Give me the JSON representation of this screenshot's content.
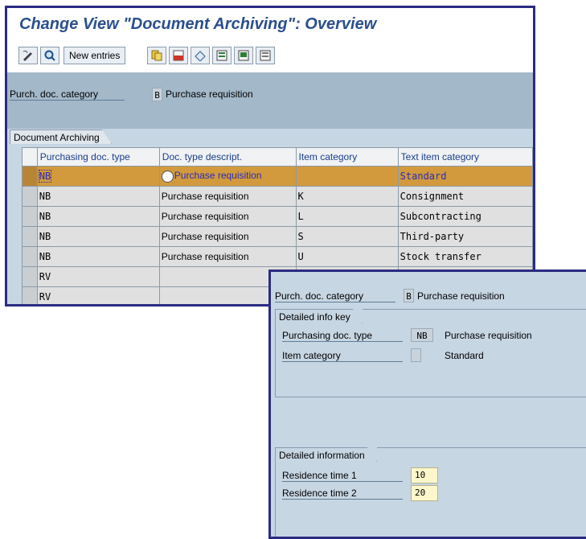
{
  "main_window": {
    "title": "Change View \"Document Archiving\": Overview",
    "toolbar": {
      "new_entries_label": "New entries"
    },
    "header": {
      "category_label": "Purch. doc. category",
      "category_key": "B",
      "category_text": "Purchase requisition"
    },
    "section_title": "Document Archiving",
    "table": {
      "columns": [
        "Purchasing doc. type",
        "Doc. type descript.",
        "Item category",
        "Text item category"
      ],
      "rows": [
        [
          "NB",
          "Purchase requisition",
          "",
          "Standard"
        ],
        [
          "NB",
          "Purchase requisition",
          "K",
          "Consignment"
        ],
        [
          "NB",
          "Purchase requisition",
          "L",
          "Subcontracting"
        ],
        [
          "NB",
          "Purchase requisition",
          "S",
          "Third-party"
        ],
        [
          "NB",
          "Purchase requisition",
          "U",
          "Stock transfer"
        ],
        [
          "RV",
          "",
          "",
          ""
        ],
        [
          "RV",
          "",
          "",
          ""
        ]
      ],
      "highlighted_row": 0,
      "highlight_color": "#d29a3c"
    }
  },
  "detail_window": {
    "category_label": "Purch. doc. category",
    "category_key": "B",
    "category_text": "Purchase requisition",
    "info_key_title": "Detailed info key",
    "doc_type_label": "Purchasing doc. type",
    "doc_type_value": "NB",
    "doc_type_text": "Purchase requisition",
    "item_category_label": "Item category",
    "item_category_value": "",
    "item_category_text": "Standard",
    "info_title": "Detailed information",
    "residence1_label": "Residence time 1",
    "residence1_value": "10",
    "residence2_label": "Residence time 2",
    "residence2_value": "20"
  },
  "colors": {
    "frame_border": "#2b2b82",
    "title_text": "#2a4f8f",
    "input_bg": "#fff7cc"
  }
}
